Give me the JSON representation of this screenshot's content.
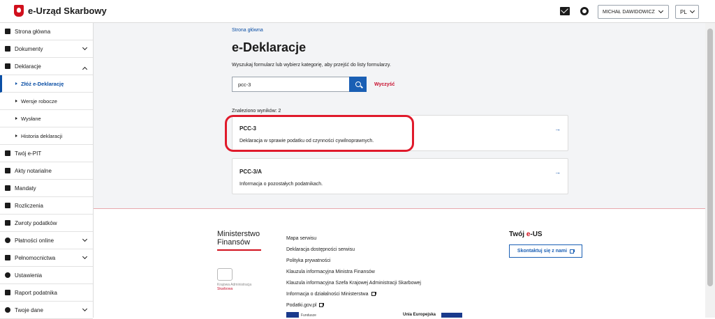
{
  "header": {
    "app_name": "e-Urząd Skarbowy",
    "user_button": "MICHAŁ DAWIDOWICZ",
    "lang_button": "PL"
  },
  "sidebar": {
    "items": [
      {
        "label": "Strona główna",
        "icon": "home-icon"
      },
      {
        "label": "Dokumenty",
        "icon": "document-icon",
        "expand": "chevron-down-icon"
      },
      {
        "label": "Deklaracje",
        "icon": "declaration-icon",
        "expand": "chevron-up-icon"
      },
      {
        "label": "Złóż e-Deklarację",
        "sub": true,
        "active": true
      },
      {
        "label": "Wersje robocze",
        "sub": true
      },
      {
        "label": "Wysłane",
        "sub": true
      },
      {
        "label": "Historia deklaracji",
        "sub": true
      },
      {
        "label": "Twój e-PIT",
        "icon": "pit-icon"
      },
      {
        "label": "Akty notarialne",
        "icon": "notary-icon"
      },
      {
        "label": "Mandaty",
        "icon": "hammer-icon"
      },
      {
        "label": "Rozliczenia",
        "icon": "wallet-icon"
      },
      {
        "label": "Zwroty podatków",
        "icon": "refund-icon"
      },
      {
        "label": "Płatności online",
        "icon": "payment-icon",
        "expand": "chevron-down-icon"
      },
      {
        "label": "Pełnomocnictwa",
        "icon": "proxy-icon",
        "expand": "chevron-down-icon"
      },
      {
        "label": "Ustawienia",
        "icon": "settings-icon"
      },
      {
        "label": "Raport podatnika",
        "icon": "report-icon"
      },
      {
        "label": "Twoje dane",
        "icon": "user-icon",
        "expand": "chevron-down-icon"
      }
    ]
  },
  "main": {
    "breadcrumb": "Strona główna",
    "title": "e-Deklaracje",
    "description": "Wyszukaj formularz lub wybierz kategorię, aby przejść do listy formularzy.",
    "search_value": "pcc-3",
    "clear_label": "Wyczyść",
    "results_count": "Znaleziono wyników: 2",
    "results": [
      {
        "code": "PCC-3",
        "desc": "Deklaracja w sprawie podatku od czynności cywilnoprawnych."
      },
      {
        "code": "PCC-3/A",
        "desc": "Informacja o pozostałych podatnikach."
      }
    ]
  },
  "footer": {
    "ministry": "Ministerstwo Finansów",
    "kas_line1": "Krajowa Administracja",
    "kas_line2": "Skarbowa",
    "links": [
      "Mapa serwisu",
      "Deklaracja dostępności serwisu",
      "Polityka prywatności",
      "Klauzula informacyjna Ministra Finansów",
      "Klauzula informacyjna Szefa Krajowej Administracji Skarbowej",
      "Informacja o działalności Ministerstwa",
      "Podatki.gov.pl"
    ],
    "eus_prefix": "Twój ",
    "eus_e": "e",
    "eus_suffix": "-US",
    "contact_button": "Skontaktuj się z nami",
    "fund_text": "Fundusze",
    "ue_text": "Unia Europejska"
  },
  "colors": {
    "accent": "#1a5fb4",
    "brand_red": "#d1101d",
    "highlight": "#e01a2b"
  }
}
